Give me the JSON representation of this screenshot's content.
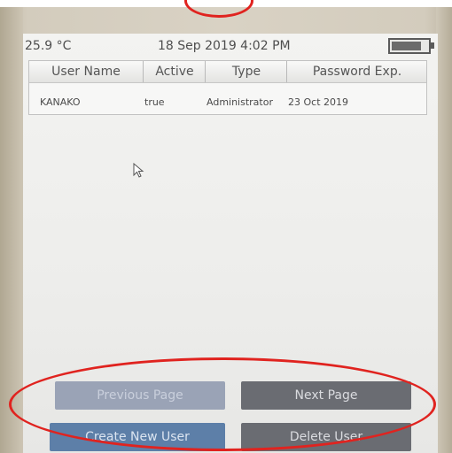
{
  "status": {
    "temperature": "25.9 °C",
    "datetime": "18 Sep 2019 4:02 PM",
    "battery_level": 0.85
  },
  "table": {
    "columns": [
      "User Name",
      "Active",
      "Type",
      "Password Exp."
    ],
    "rows": [
      [
        "KANAKO",
        "true",
        "Administrator",
        "23 Oct 2019"
      ]
    ]
  },
  "buttons": {
    "previous_page": "Previous Page",
    "next_page": "Next Page",
    "create_new_user": "Create New User",
    "delete_user": "Delete User"
  },
  "icons": {
    "cursor": "mouse-pointer-icon",
    "battery": "battery-icon"
  },
  "colors": {
    "highlight": "#e0231f",
    "create_button": "#5d7fa8",
    "dark_button": "#6a6c72",
    "disabled_button": "#9aa3b6"
  }
}
